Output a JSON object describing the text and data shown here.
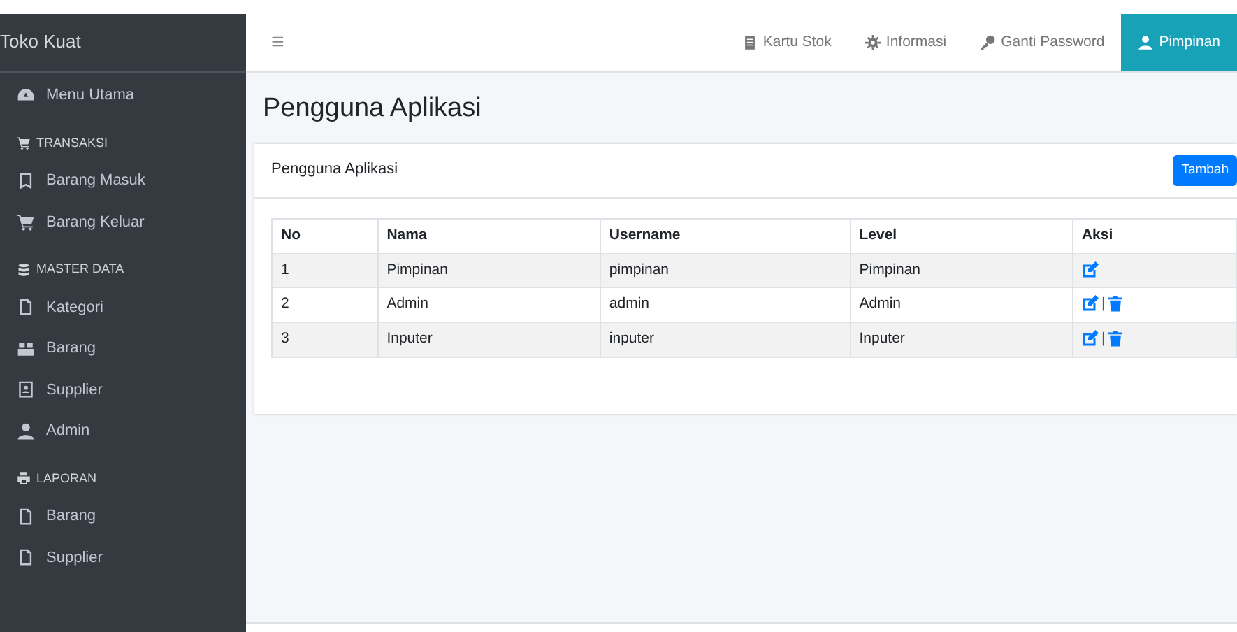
{
  "brand": "Toko Kuat",
  "sidebar": [
    {
      "kind": "item",
      "label": "Menu Utama"
    },
    {
      "kind": "header",
      "label": "TRANSAKSI"
    },
    {
      "kind": "item",
      "label": "Barang Masuk"
    },
    {
      "kind": "item",
      "label": "Barang Keluar"
    },
    {
      "kind": "header",
      "label": "MASTER DATA"
    },
    {
      "kind": "item",
      "label": "Kategori"
    },
    {
      "kind": "item",
      "label": "Barang"
    },
    {
      "kind": "item",
      "label": "Supplier"
    },
    {
      "kind": "item",
      "label": "Admin"
    },
    {
      "kind": "header",
      "label": "LAPORAN"
    },
    {
      "kind": "item",
      "label": "Barang"
    },
    {
      "kind": "item",
      "label": "Supplier"
    }
  ],
  "navbar": {
    "toggle": "≡",
    "links": [
      {
        "label": "Kartu Stok",
        "selected": false
      },
      {
        "label": "Informasi",
        "selected": false
      },
      {
        "label": "Ganti Password",
        "selected": false
      },
      {
        "label": "Pimpinan",
        "selected": true
      }
    ]
  },
  "page_title": "Pengguna Aplikasi",
  "card": {
    "title": "Pengguna Aplikasi",
    "button": "Tambah",
    "table": {
      "columns": [
        "No",
        "Nama",
        "Username",
        "Level",
        "Aksi"
      ],
      "rows": [
        {
          "cells": [
            "1",
            "Pimpinan",
            "pimpinan",
            "Pimpinan"
          ],
          "actions": [
            {
              "kind": "edit"
            }
          ]
        },
        {
          "cells": [
            "2",
            "Admin",
            "admin",
            "Admin"
          ],
          "actions": [
            {
              "kind": "edit"
            },
            {
              "kind": "separator",
              "text": "|"
            },
            {
              "kind": "delete"
            }
          ]
        },
        {
          "cells": [
            "3",
            "Inputer",
            "inputer",
            "Inputer"
          ],
          "actions": [
            {
              "kind": "edit"
            },
            {
              "kind": "separator",
              "text": "|"
            },
            {
              "kind": "delete"
            }
          ]
        }
      ]
    }
  }
}
